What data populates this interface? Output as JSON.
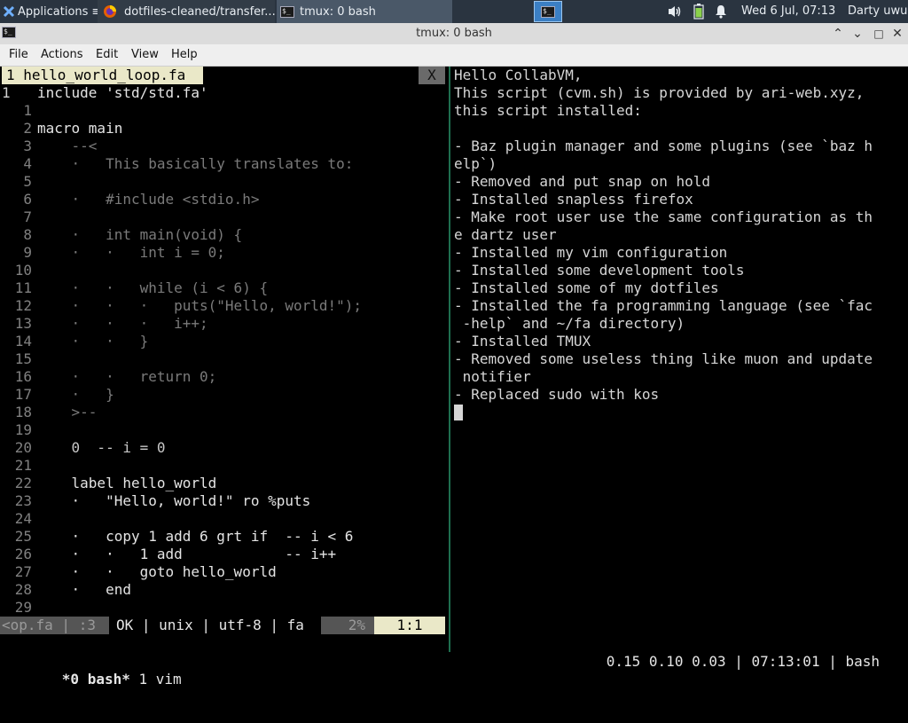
{
  "panel": {
    "apps_label": "Applications",
    "tasks": [
      {
        "label": "dotfiles-cleaned/transfer...",
        "icon": "firefox-icon"
      },
      {
        "label": "tmux: 0 bash",
        "icon": "terminal-icon"
      }
    ],
    "clock": "Wed  6 Jul, 07:13",
    "user": "Darty uwu"
  },
  "window": {
    "title": "tmux: 0 bash"
  },
  "menubar": [
    "File",
    "Actions",
    "Edit",
    "View",
    "Help"
  ],
  "vim": {
    "tab_label": "1 hello_world_loop.fa",
    "close_label": "X",
    "line_numbers": [
      "1",
      "1",
      "2",
      "3",
      "4",
      "5",
      "6",
      "7",
      "8",
      "9",
      "10",
      "11",
      "12",
      "13",
      "14",
      "15",
      "16",
      "17",
      "18",
      "19",
      "20",
      "21",
      "22",
      "23",
      "24",
      "25",
      "26",
      "27",
      "28",
      "29"
    ],
    "code_lines": [
      "include 'std/std.fa'",
      "",
      "macro main",
      "    --<",
      "    ·   This basically translates to:",
      "",
      "    ·   #include <stdio.h>",
      "",
      "    ·   int main(void) {",
      "    ·   ·   int i = 0;",
      "",
      "    ·   ·   while (i < 6) {",
      "    ·   ·   ·   puts(\"Hello, world!\");",
      "    ·   ·   ·   i++;",
      "    ·   ·   }",
      "",
      "    ·   ·   return 0;",
      "    ·   }",
      "    >--",
      "",
      "    0  -- i = 0",
      "",
      "    label hello_world",
      "    ·   \"Hello, world!\" ro %puts",
      "",
      "    ·   copy 1 add 6 grt if  -- i < 6",
      "    ·   ·   1 add            -- i++",
      "    ·   ·   goto hello_world",
      "    ·   end",
      ""
    ],
    "status": {
      "file": "<op.fa | :3",
      "info": "OK | unix | utf-8 | fa",
      "percent": "2%",
      "position": "1:1"
    }
  },
  "shell": {
    "lines": [
      "Hello CollabVM,",
      "This script (cvm.sh) is provided by ari-web.xyz,",
      "this script installed:",
      "",
      "- Baz plugin manager and some plugins (see `baz h",
      "elp`)",
      "- Removed and put snap on hold",
      "- Installed snapless firefox",
      "- Make root user use the same configuration as th",
      "e dartz user",
      "- Installed my vim configuration",
      "- Installed some development tools",
      "- Installed some of my dotfiles",
      "- Installed the fa programming language (see `fac",
      " -help` and ~/fa directory)",
      "- Installed TMUX",
      "- Removed some useless thing like muon and update",
      " notifier",
      "- Replaced sudo with kos"
    ]
  },
  "tmux": {
    "active_window": "*0 bash*",
    "other_window": " 1 vim",
    "right_status": "0.15 0.10 0.03 | 07:13:01 | bash"
  },
  "colors": {
    "panel_bg": "#2a3440",
    "workspace_accent": "#3b7fc4",
    "vim_tab": "#eae8c8",
    "pane_divider": "#1e6e4e"
  }
}
